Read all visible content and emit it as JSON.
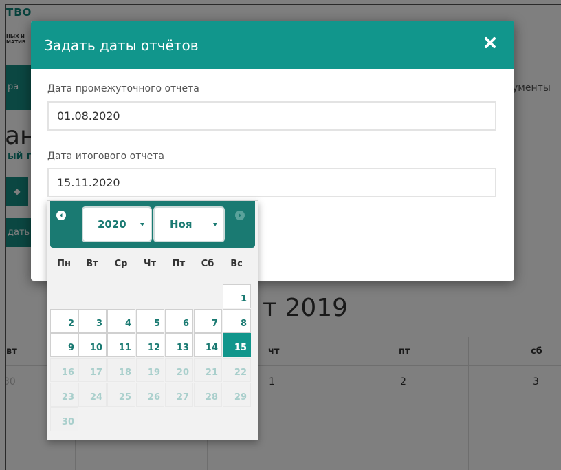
{
  "background": {
    "logo_text": "ТВО",
    "logo_sub_line1": "НЫХ И",
    "logo_sub_line2": "МАТИВ",
    "tab_text": "ра",
    "docs_text": "ументы",
    "heading_text": "ан",
    "sub_text": "ый г",
    "sort_icon_text": "◆",
    "add_text": "дать",
    "month_title": "т 2019",
    "col_headers": [
      "вт",
      "чт",
      "пт",
      "сб"
    ],
    "day_numbers": [
      "30",
      "1",
      "2",
      "3"
    ]
  },
  "modal": {
    "title": "Задать даты отчётов",
    "close_icon": "close-icon",
    "interim_label": "Дата промежуточного отчета",
    "interim_value": "01.08.2020",
    "final_label": "Дата итогового отчета",
    "final_value": "15.11.2020"
  },
  "datepicker": {
    "selected_year": "2020",
    "selected_month": "Ноя",
    "weekdays": [
      "Пн",
      "Вт",
      "Ср",
      "Чт",
      "Пт",
      "Сб",
      "Вс"
    ],
    "days": [
      [
        "",
        "",
        "",
        "",
        "",
        "",
        "1"
      ],
      [
        "2",
        "3",
        "4",
        "5",
        "6",
        "7",
        "8"
      ],
      [
        "9",
        "10",
        "11",
        "12",
        "13",
        "14",
        "15"
      ],
      [
        "16",
        "17",
        "18",
        "19",
        "20",
        "21",
        "22"
      ],
      [
        "23",
        "24",
        "25",
        "26",
        "27",
        "28",
        "29"
      ],
      [
        "30",
        "",
        "",
        "",
        "",
        "",
        ""
      ]
    ],
    "selected_day": "15",
    "enabled_through_day": 15
  },
  "colors": {
    "accent": "#11968c",
    "accent_dark": "#1a7a72",
    "disabled_text": "#a9cfcc"
  }
}
